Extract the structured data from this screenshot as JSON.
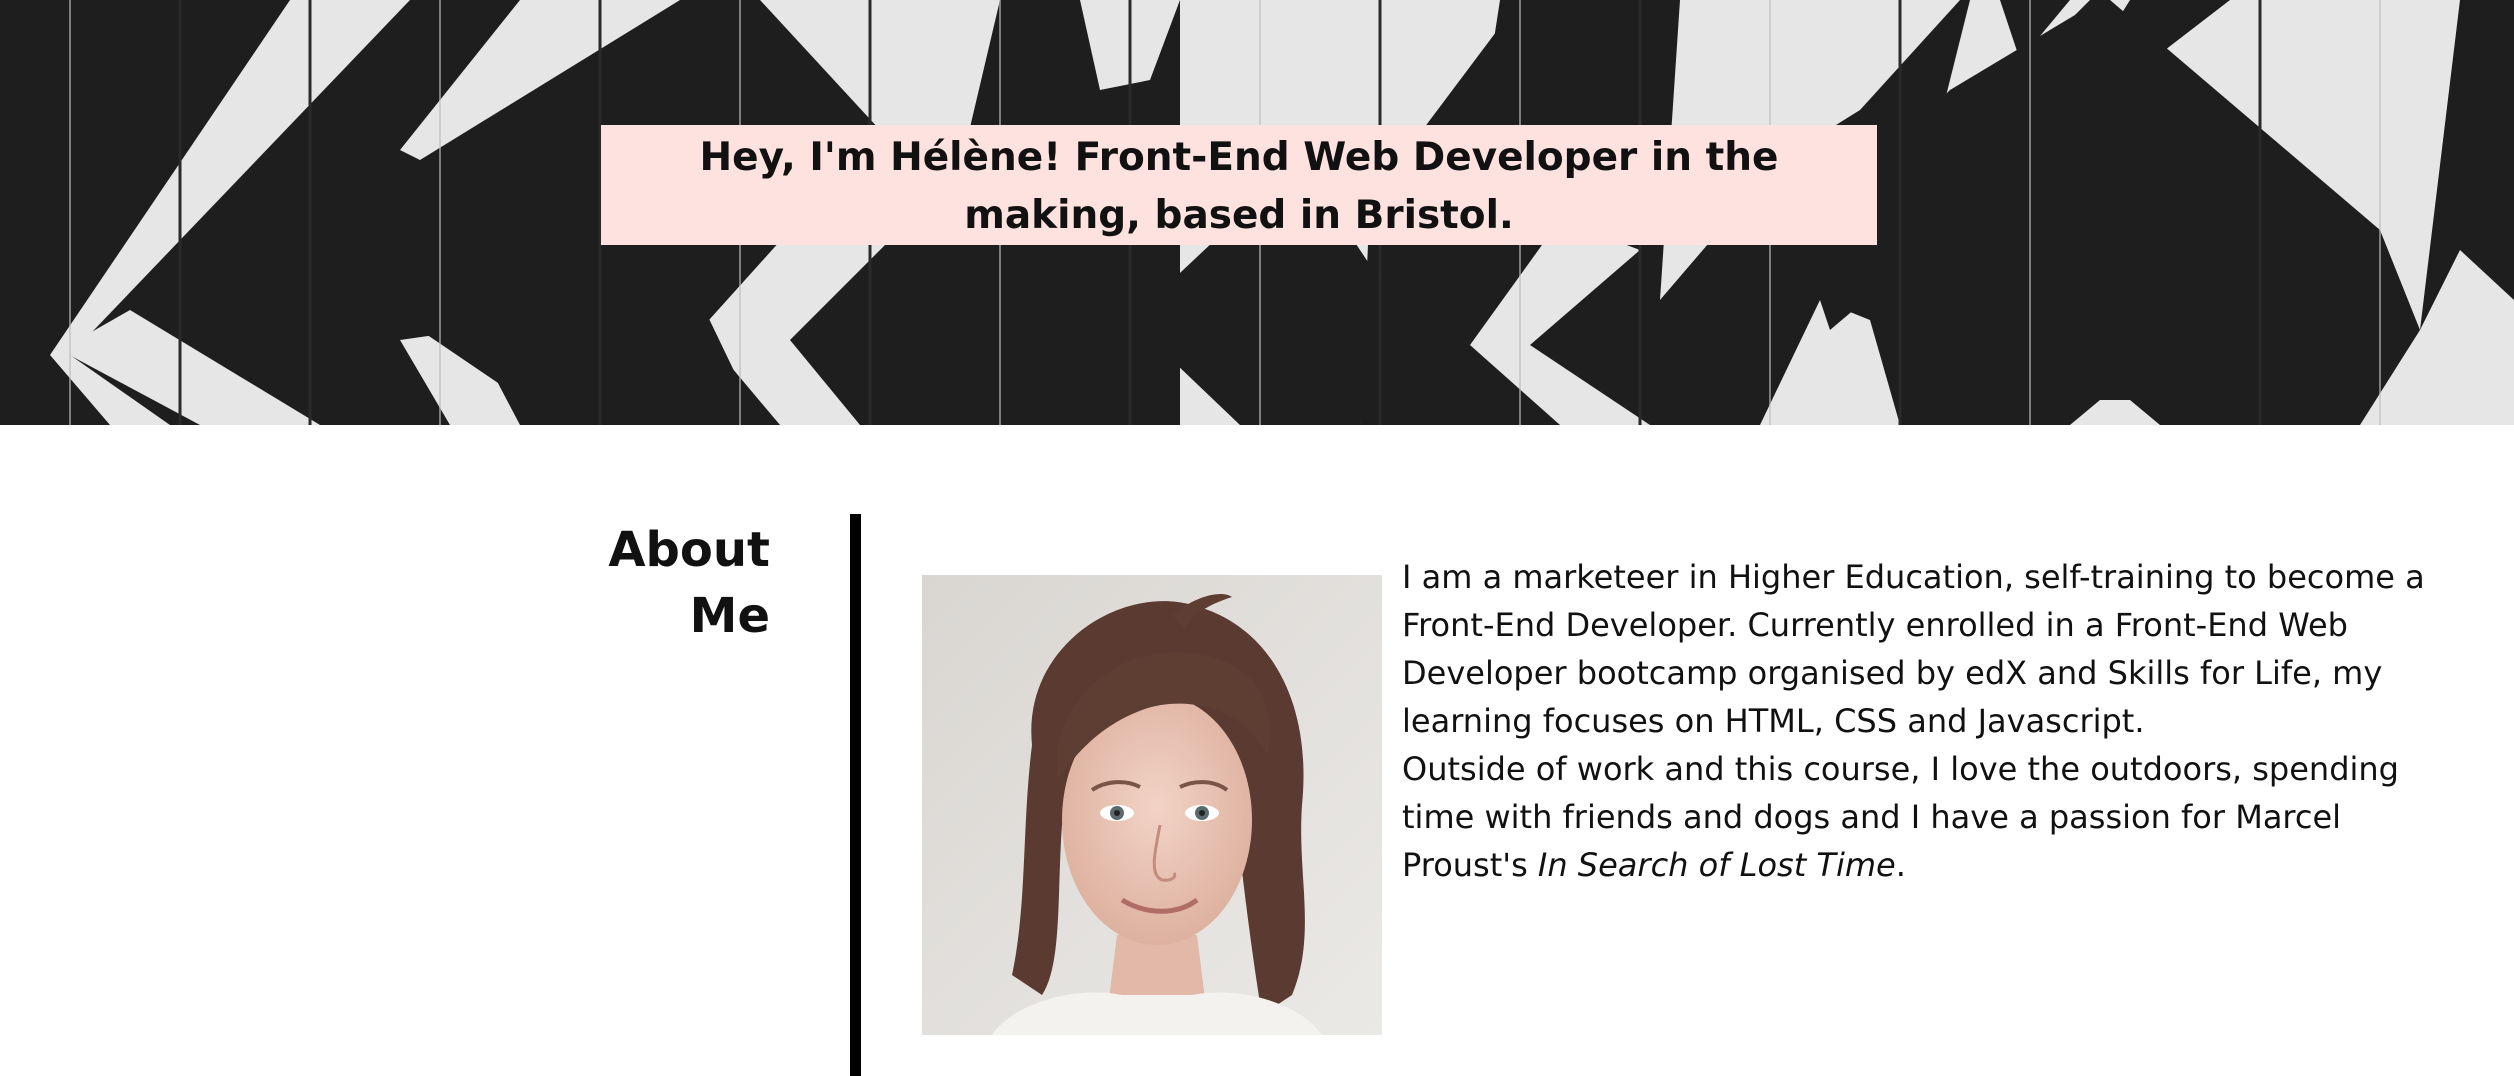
{
  "hero": {
    "title": "Hey, I'm Hélène! Front-End Web Developer in the making, based in Bristol.",
    "title_bg_color": "#fde2df",
    "pattern_colors": [
      "#1e1e1e",
      "#e6e6e6"
    ]
  },
  "about": {
    "heading": "About Me",
    "paragraph1": "I am a marketeer in Higher Education, self-training to become a Front-End Developer. Currently enrolled in a Front-End Web Developer bootcamp organised by edX and Skills for Life, my learning focuses on HTML, CSS and Javascript.",
    "paragraph2_prefix": "Outside of work and this course, I love the outdoors, spending time with friends and dogs and I have a passion for Marcel Proust's ",
    "paragraph2_book": "In Search of Lost Time",
    "paragraph2_suffix": "."
  }
}
